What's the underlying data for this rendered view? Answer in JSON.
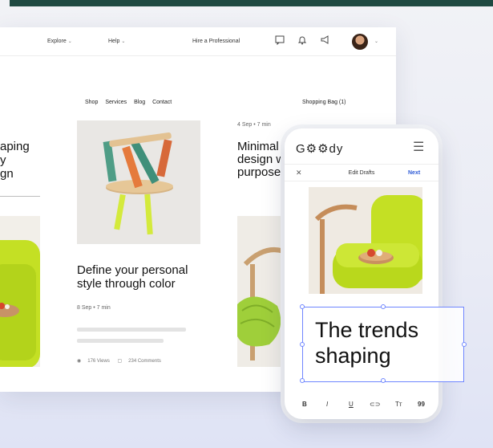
{
  "app_nav": {
    "explore": "Explore",
    "help": "Help",
    "hire": "Hire a Professional",
    "icons": [
      "chat-icon",
      "bell-icon",
      "megaphone-icon"
    ],
    "chevron": "⌄"
  },
  "site_nav": {
    "items": [
      "Shop",
      "Services",
      "Blog",
      "Contact"
    ],
    "bag": "Shopping Bag (1)"
  },
  "left_article": {
    "title_lines": [
      "aping",
      "y",
      "gn"
    ]
  },
  "middle_article": {
    "title": "Define your personal style through color",
    "meta": "8 Sep  •  7 min",
    "views": "176 Views",
    "comments": "234 Comments"
  },
  "right_article": {
    "meta": "4 Sep  •  7 min",
    "title_lines": [
      "Minimal",
      "design w",
      "purpose"
    ]
  },
  "mobile": {
    "brand": "G⚙⚙dy",
    "edit_title": "Edit Drafts",
    "next": "Next",
    "selected_text_lines": [
      "The trends",
      "shaping"
    ],
    "toolbar": [
      "B",
      "I",
      "U",
      "⊂⊃",
      "Tт",
      "99"
    ]
  },
  "colors": {
    "accent": "#2f5bd6",
    "topbar": "#1f4a42",
    "chair_green": "#c4e024",
    "selection": "#6f86ff"
  }
}
